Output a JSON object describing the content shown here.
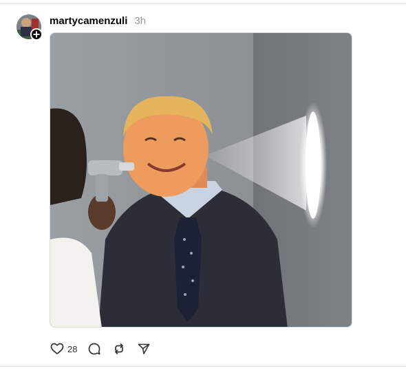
{
  "post": {
    "author": {
      "username": "martycamenzuli",
      "avatar_icon": "avatar-image",
      "follow_icon": "plus-icon"
    },
    "timestamp": "3h",
    "media": {
      "type": "image"
    },
    "actions": {
      "like": {
        "icon": "heart-icon",
        "count": "28"
      },
      "reply": {
        "icon": "speech-bubble-icon"
      },
      "repost": {
        "icon": "repost-icon"
      },
      "share": {
        "icon": "paper-plane-icon"
      }
    }
  },
  "colors": {
    "background": "#ffffff",
    "username": "#000000",
    "timestamp": "#999999",
    "divider": "#e3e3e3"
  }
}
